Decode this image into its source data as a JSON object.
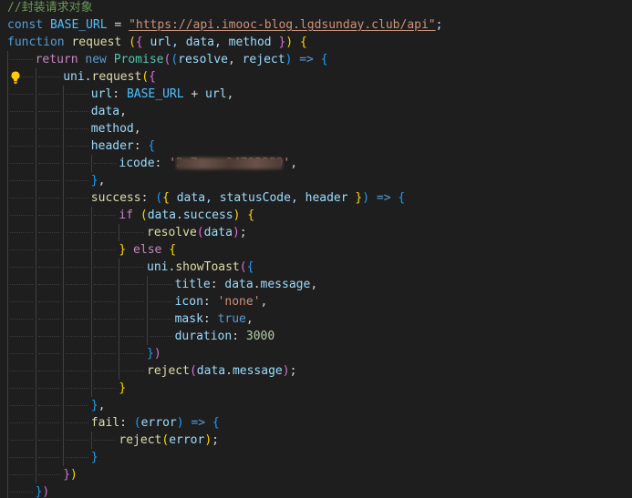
{
  "colors": {
    "comment": "#6a9955",
    "keyword": "#569cd6",
    "control": "#c586c0",
    "function": "#dcdcaa",
    "variable": "#9cdcfe",
    "constant": "#4fc1ff",
    "class": "#4ec9b0",
    "string": "#ce9178",
    "number": "#b5cea8",
    "plain": "#d4d4d4",
    "bracket1": "#ffd700",
    "bracket2": "#da70d6",
    "bracket3": "#179fff"
  },
  "icons": {
    "lightbulb": "lightbulb-icon"
  },
  "code_lines": [
    {
      "indent": 0,
      "tokens": [
        {
          "t": "//封装请求对象",
          "c": "comment"
        }
      ]
    },
    {
      "indent": 0,
      "tokens": [
        {
          "t": "const",
          "c": "keyword"
        },
        {
          "t": " ",
          "c": "plain"
        },
        {
          "t": "BASE_URL",
          "c": "constant"
        },
        {
          "t": " = ",
          "c": "plain"
        },
        {
          "t": "\"https://api.imooc-blog.lgdsunday.club/api\"",
          "c": "string",
          "u": true
        },
        {
          "t": ";",
          "c": "plain"
        }
      ]
    },
    {
      "indent": 0,
      "tokens": [
        {
          "t": "function",
          "c": "keyword"
        },
        {
          "t": " ",
          "c": "plain"
        },
        {
          "t": "request",
          "c": "function"
        },
        {
          "t": " ",
          "c": "plain"
        },
        {
          "t": "(",
          "c": "bracket1"
        },
        {
          "t": "{",
          "c": "bracket2"
        },
        {
          "t": " url, data, method ",
          "c": "variable"
        },
        {
          "t": "}",
          "c": "bracket2"
        },
        {
          "t": ")",
          "c": "bracket1"
        },
        {
          "t": " ",
          "c": "plain"
        },
        {
          "t": "{",
          "c": "bracket1"
        }
      ]
    },
    {
      "indent": 1,
      "tokens": [
        {
          "t": "return",
          "c": "control"
        },
        {
          "t": " ",
          "c": "plain"
        },
        {
          "t": "new",
          "c": "keyword"
        },
        {
          "t": " ",
          "c": "plain"
        },
        {
          "t": "Promise",
          "c": "class"
        },
        {
          "t": "(",
          "c": "bracket2"
        },
        {
          "t": "(",
          "c": "bracket3"
        },
        {
          "t": "resolve",
          "c": "variable"
        },
        {
          "t": ", ",
          "c": "plain"
        },
        {
          "t": "reject",
          "c": "variable"
        },
        {
          "t": ")",
          "c": "bracket3"
        },
        {
          "t": " ",
          "c": "plain"
        },
        {
          "t": "=>",
          "c": "keyword"
        },
        {
          "t": " ",
          "c": "plain"
        },
        {
          "t": "{",
          "c": "bracket3"
        }
      ]
    },
    {
      "indent": 2,
      "bulb": true,
      "tokens": [
        {
          "t": "uni",
          "c": "variable"
        },
        {
          "t": ".",
          "c": "plain"
        },
        {
          "t": "request",
          "c": "function"
        },
        {
          "t": "(",
          "c": "bracket1"
        },
        {
          "t": "{",
          "c": "bracket2"
        }
      ]
    },
    {
      "indent": 3,
      "tokens": [
        {
          "t": "url",
          "c": "variable"
        },
        {
          "t": ": ",
          "c": "plain"
        },
        {
          "t": "BASE_URL",
          "c": "constant"
        },
        {
          "t": " + ",
          "c": "plain"
        },
        {
          "t": "url",
          "c": "variable"
        },
        {
          "t": ",",
          "c": "plain"
        }
      ]
    },
    {
      "indent": 3,
      "tokens": [
        {
          "t": "data",
          "c": "variable"
        },
        {
          "t": ",",
          "c": "plain"
        }
      ]
    },
    {
      "indent": 3,
      "tokens": [
        {
          "t": "method",
          "c": "variable"
        },
        {
          "t": ",",
          "c": "plain"
        }
      ]
    },
    {
      "indent": 3,
      "tokens": [
        {
          "t": "header",
          "c": "variable"
        },
        {
          "t": ": ",
          "c": "plain"
        },
        {
          "t": "{",
          "c": "bracket3"
        }
      ]
    },
    {
      "indent": 4,
      "tokens": [
        {
          "t": "icode",
          "c": "variable"
        },
        {
          "t": ": ",
          "c": "plain"
        },
        {
          "t": "'",
          "c": "string"
        },
        {
          "t": "2●7●●●●94702889",
          "c": "string",
          "redact": true
        },
        {
          "t": "'",
          "c": "string"
        },
        {
          "t": ",",
          "c": "plain"
        }
      ]
    },
    {
      "indent": 3,
      "tokens": [
        {
          "t": "}",
          "c": "bracket3"
        },
        {
          "t": ",",
          "c": "plain"
        }
      ]
    },
    {
      "indent": 3,
      "tokens": [
        {
          "t": "success",
          "c": "function"
        },
        {
          "t": ": ",
          "c": "plain"
        },
        {
          "t": "(",
          "c": "bracket3"
        },
        {
          "t": "{",
          "c": "bracket1"
        },
        {
          "t": " data, statusCode, header ",
          "c": "variable"
        },
        {
          "t": "}",
          "c": "bracket1"
        },
        {
          "t": ")",
          "c": "bracket3"
        },
        {
          "t": " ",
          "c": "plain"
        },
        {
          "t": "=>",
          "c": "keyword"
        },
        {
          "t": " ",
          "c": "plain"
        },
        {
          "t": "{",
          "c": "bracket3"
        }
      ]
    },
    {
      "indent": 4,
      "tokens": [
        {
          "t": "if",
          "c": "control"
        },
        {
          "t": " ",
          "c": "plain"
        },
        {
          "t": "(",
          "c": "bracket1"
        },
        {
          "t": "data",
          "c": "variable"
        },
        {
          "t": ".",
          "c": "plain"
        },
        {
          "t": "success",
          "c": "variable"
        },
        {
          "t": ")",
          "c": "bracket1"
        },
        {
          "t": " ",
          "c": "plain"
        },
        {
          "t": "{",
          "c": "bracket1"
        }
      ]
    },
    {
      "indent": 5,
      "tokens": [
        {
          "t": "resolve",
          "c": "function"
        },
        {
          "t": "(",
          "c": "bracket2"
        },
        {
          "t": "data",
          "c": "variable"
        },
        {
          "t": ")",
          "c": "bracket2"
        },
        {
          "t": ";",
          "c": "plain"
        }
      ]
    },
    {
      "indent": 4,
      "tokens": [
        {
          "t": "}",
          "c": "bracket1"
        },
        {
          "t": " ",
          "c": "plain"
        },
        {
          "t": "else",
          "c": "control"
        },
        {
          "t": " ",
          "c": "plain"
        },
        {
          "t": "{",
          "c": "bracket1"
        }
      ]
    },
    {
      "indent": 5,
      "tokens": [
        {
          "t": "uni",
          "c": "variable"
        },
        {
          "t": ".",
          "c": "plain"
        },
        {
          "t": "showToast",
          "c": "function"
        },
        {
          "t": "(",
          "c": "bracket2"
        },
        {
          "t": "{",
          "c": "bracket3"
        }
      ]
    },
    {
      "indent": 6,
      "tokens": [
        {
          "t": "title",
          "c": "variable"
        },
        {
          "t": ": ",
          "c": "plain"
        },
        {
          "t": "data",
          "c": "variable"
        },
        {
          "t": ".",
          "c": "plain"
        },
        {
          "t": "message",
          "c": "variable"
        },
        {
          "t": ",",
          "c": "plain"
        }
      ]
    },
    {
      "indent": 6,
      "tokens": [
        {
          "t": "icon",
          "c": "variable"
        },
        {
          "t": ": ",
          "c": "plain"
        },
        {
          "t": "'none'",
          "c": "string"
        },
        {
          "t": ",",
          "c": "plain"
        }
      ]
    },
    {
      "indent": 6,
      "tokens": [
        {
          "t": "mask",
          "c": "variable"
        },
        {
          "t": ": ",
          "c": "plain"
        },
        {
          "t": "true",
          "c": "keyword"
        },
        {
          "t": ",",
          "c": "plain"
        }
      ]
    },
    {
      "indent": 6,
      "tokens": [
        {
          "t": "duration",
          "c": "variable"
        },
        {
          "t": ": ",
          "c": "plain"
        },
        {
          "t": "3000",
          "c": "number"
        }
      ]
    },
    {
      "indent": 5,
      "tokens": [
        {
          "t": "}",
          "c": "bracket3"
        },
        {
          "t": ")",
          "c": "bracket2"
        }
      ]
    },
    {
      "indent": 5,
      "tokens": [
        {
          "t": "reject",
          "c": "function"
        },
        {
          "t": "(",
          "c": "bracket2"
        },
        {
          "t": "data",
          "c": "variable"
        },
        {
          "t": ".",
          "c": "plain"
        },
        {
          "t": "message",
          "c": "variable"
        },
        {
          "t": ")",
          "c": "bracket2"
        },
        {
          "t": ";",
          "c": "plain"
        }
      ]
    },
    {
      "indent": 4,
      "tokens": [
        {
          "t": "}",
          "c": "bracket1"
        }
      ]
    },
    {
      "indent": 3,
      "tokens": [
        {
          "t": "}",
          "c": "bracket3"
        },
        {
          "t": ",",
          "c": "plain"
        }
      ]
    },
    {
      "indent": 3,
      "tokens": [
        {
          "t": "fail",
          "c": "function"
        },
        {
          "t": ": ",
          "c": "plain"
        },
        {
          "t": "(",
          "c": "bracket3"
        },
        {
          "t": "error",
          "c": "variable"
        },
        {
          "t": ")",
          "c": "bracket3"
        },
        {
          "t": " ",
          "c": "plain"
        },
        {
          "t": "=>",
          "c": "keyword"
        },
        {
          "t": " ",
          "c": "plain"
        },
        {
          "t": "{",
          "c": "bracket3"
        }
      ]
    },
    {
      "indent": 4,
      "tokens": [
        {
          "t": "reject",
          "c": "function"
        },
        {
          "t": "(",
          "c": "bracket1"
        },
        {
          "t": "error",
          "c": "variable"
        },
        {
          "t": ")",
          "c": "bracket1"
        },
        {
          "t": ";",
          "c": "plain"
        }
      ]
    },
    {
      "indent": 3,
      "tokens": [
        {
          "t": "}",
          "c": "bracket3"
        }
      ]
    },
    {
      "indent": 2,
      "tokens": [
        {
          "t": "}",
          "c": "bracket2"
        },
        {
          "t": ")",
          "c": "bracket1"
        }
      ]
    },
    {
      "indent": 1,
      "tokens": [
        {
          "t": "}",
          "c": "bracket3"
        },
        {
          "t": ")",
          "c": "bracket2"
        }
      ]
    }
  ]
}
